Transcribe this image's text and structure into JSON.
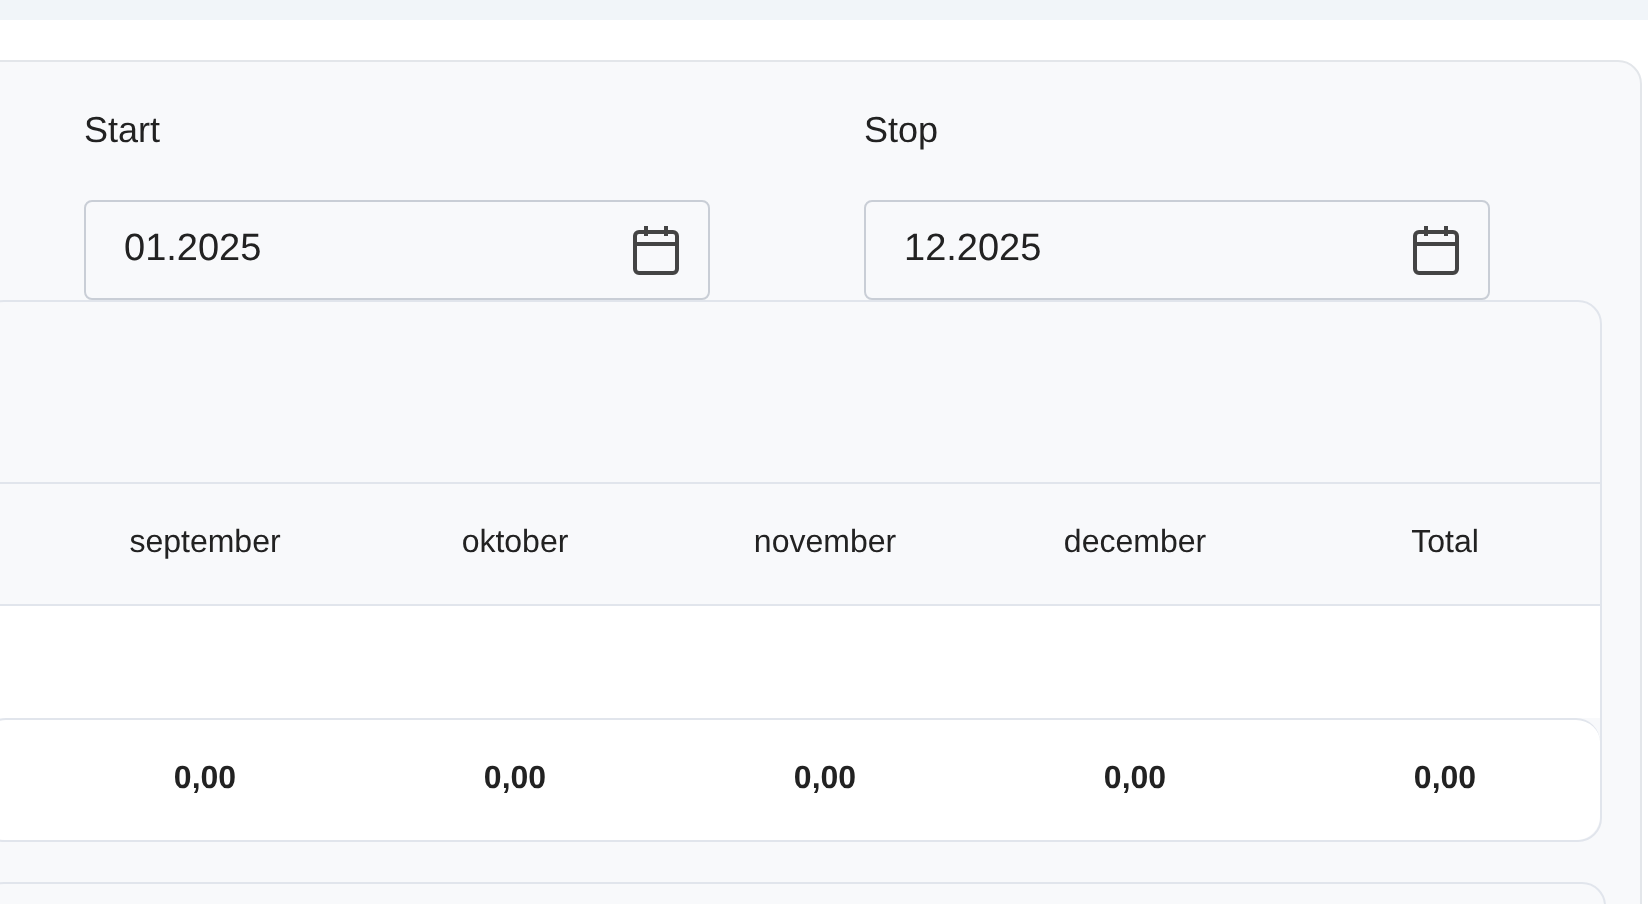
{
  "filters": [
    {
      "label": "Start",
      "value": "01.2025"
    },
    {
      "label": "Stop",
      "value": "12.2025"
    }
  ],
  "table": {
    "columns": [
      "september",
      "oktober",
      "november",
      "december",
      "Total"
    ],
    "total_row": [
      "0,00",
      "0,00",
      "0,00",
      "0,00",
      "0,00"
    ]
  }
}
